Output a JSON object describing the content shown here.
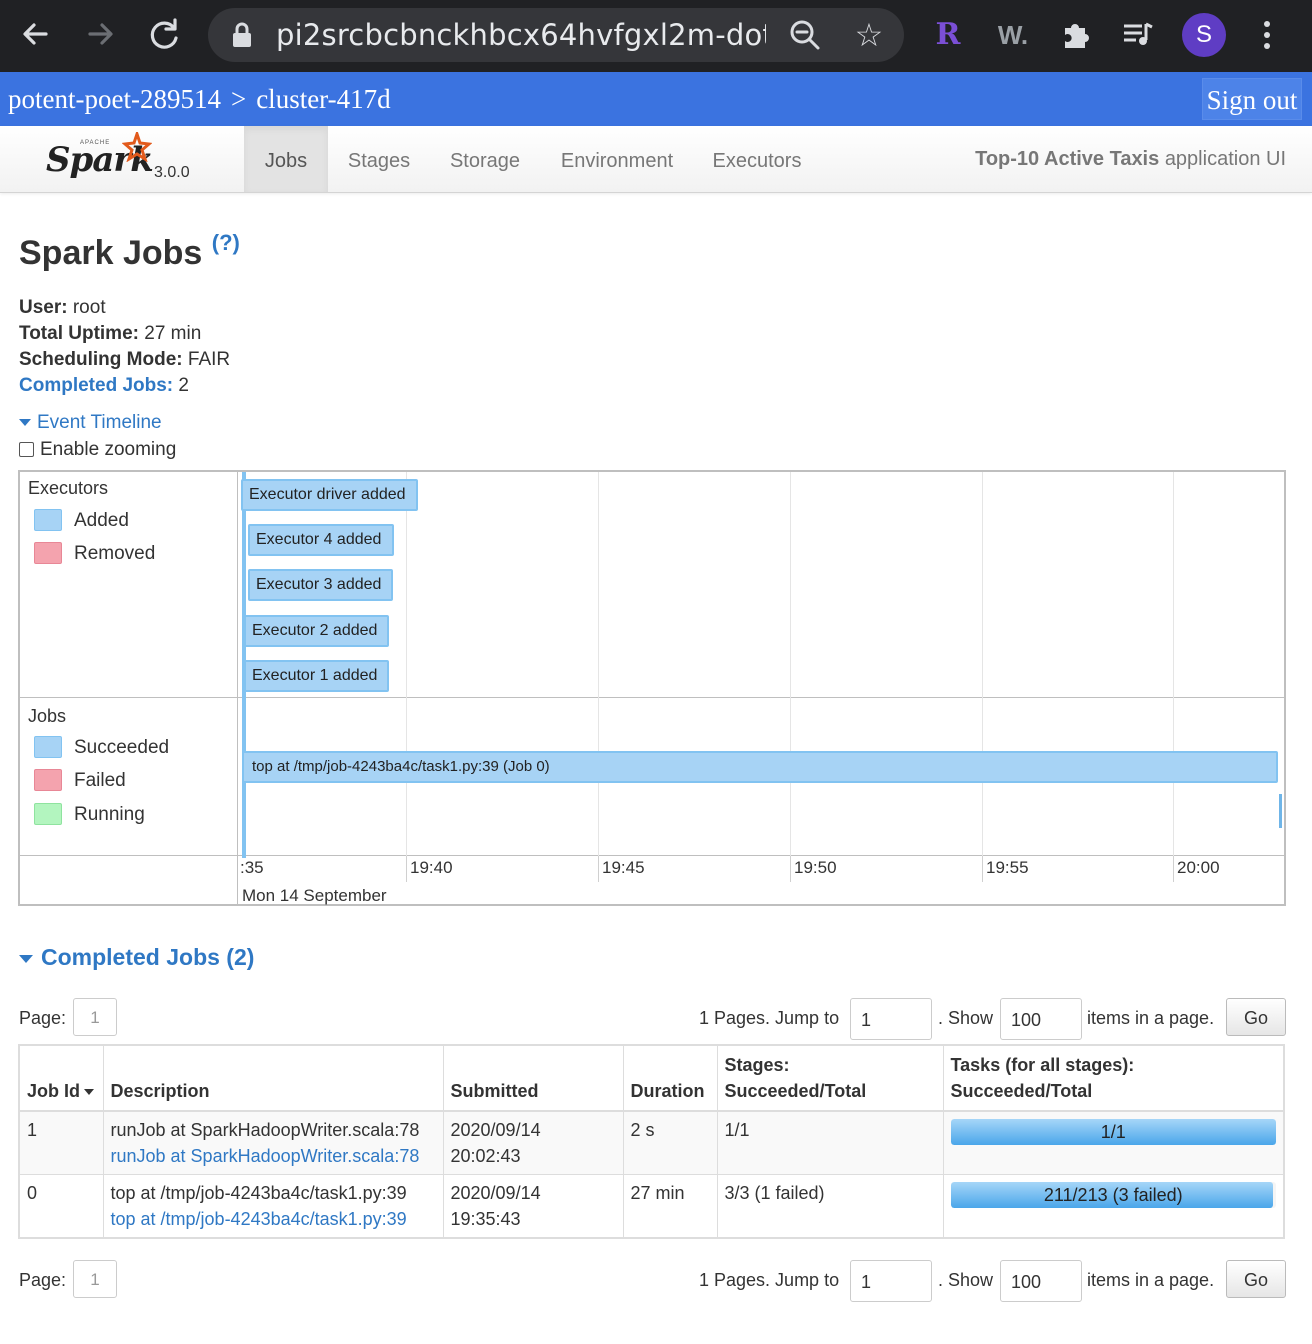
{
  "browser": {
    "url": "pi2srcbcbnckhbcx64hvfgxl2m-dot...",
    "profile_initial": "S",
    "extensions": [
      "R",
      "W."
    ]
  },
  "header": {
    "project": "potent-poet-289514",
    "separator": ">",
    "cluster": "cluster-417d",
    "signout_label": "Sign out"
  },
  "spark_nav": {
    "brand_apache": "APACHE",
    "brand": "Spark",
    "version": "3.0.0",
    "tabs": [
      "Jobs",
      "Stages",
      "Storage",
      "Environment",
      "Executors"
    ],
    "active_tab": "Jobs",
    "app_name": "Top-10 Active Taxis",
    "app_suffix": "application UI"
  },
  "page": {
    "title": "Spark Jobs",
    "help": "(?)",
    "user_label": "User:",
    "user": "root",
    "uptime_label": "Total Uptime:",
    "uptime": "27 min",
    "scheduling_label": "Scheduling Mode:",
    "scheduling": "FAIR",
    "completed_label": "Completed Jobs:",
    "completed": "2"
  },
  "timeline": {
    "toggle_label": "Event Timeline",
    "zoom_label": "Enable zooming",
    "executors_group": "Executors",
    "executors_legend": [
      "Added",
      "Removed"
    ],
    "jobs_group": "Jobs",
    "jobs_legend": [
      "Succeeded",
      "Failed",
      "Running"
    ],
    "executor_events": [
      "Executor driver added",
      "Executor 4 added",
      "Executor 3 added",
      "Executor 2 added",
      "Executor 1 added"
    ],
    "job_event": "top at /tmp/job-4243ba4c/task1.py:39 (Job 0)",
    "ticks": [
      ":35",
      "19:40",
      "19:45",
      "19:50",
      "19:55",
      "20:00"
    ],
    "date": "Mon 14 September",
    "colors": {
      "added": "#a7d3f5",
      "removed": "#f4a3ae",
      "running": "#b3f5bf"
    }
  },
  "completed_jobs": {
    "title": "Completed Jobs (2)",
    "pager": {
      "page_label": "Page:",
      "page": "1",
      "jump_text": "1 Pages. Jump to",
      "jump_value": "1",
      "show_text": ". Show",
      "show_value": "100",
      "items_text": "items in a page.",
      "go_label": "Go"
    },
    "headers": {
      "job_id": "Job Id",
      "description": "Description",
      "submitted": "Submitted",
      "duration": "Duration",
      "stages": "Stages: Succeeded/Total",
      "tasks": "Tasks (for all stages): Succeeded/Total"
    },
    "rows": [
      {
        "id": "1",
        "desc": "runJob at SparkHadoopWriter.scala:78",
        "desc_link": "runJob at SparkHadoopWriter.scala:78",
        "submitted_date": "2020/09/14",
        "submitted_time": "20:02:43",
        "duration": "2 s",
        "stages": "1/1",
        "tasks": "1/1",
        "task_progress": 1.0
      },
      {
        "id": "0",
        "desc": "top at /tmp/job-4243ba4c/task1.py:39",
        "desc_link": "top at /tmp/job-4243ba4c/task1.py:39",
        "submitted_date": "2020/09/14",
        "submitted_time": "19:35:43",
        "duration": "27 min",
        "stages": "3/3 (1 failed)",
        "tasks": "211/213 (3 failed)",
        "task_progress": 0.99
      }
    ]
  }
}
